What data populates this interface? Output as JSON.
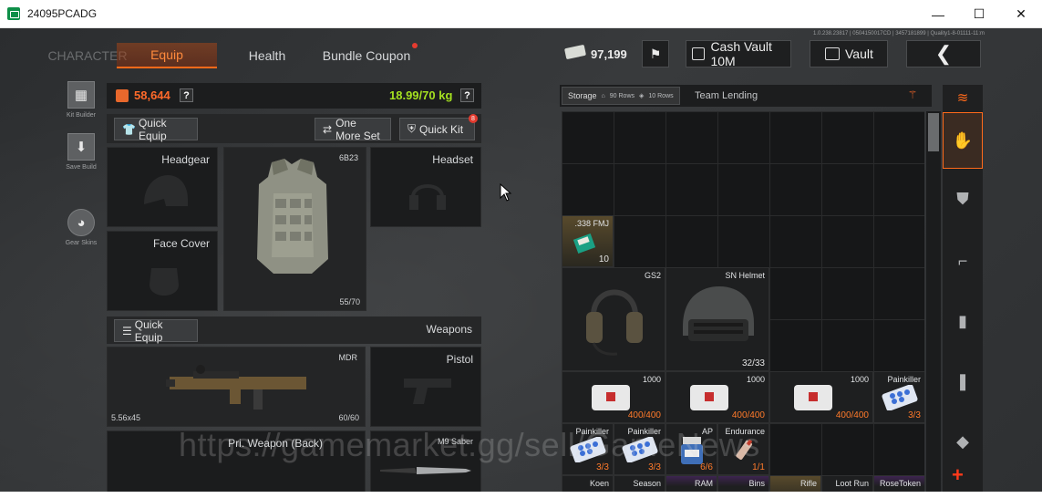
{
  "window": {
    "title": "24095PCADG",
    "minimize": "—",
    "maximize": "☐",
    "close": "✕"
  },
  "nav": {
    "character": "CHARACTER",
    "equip": "Equip",
    "health": "Health",
    "bundle": "Bundle Coupon"
  },
  "version_text": "1.0.238.23817 | 0504150017CD | 3457181899 | Quality1-8-01111-11:m",
  "currency": {
    "cash": "97,199"
  },
  "top_buttons": {
    "cash_vault": "Cash Vault 10M",
    "vault": "Vault",
    "back": "❮"
  },
  "side_tools": [
    {
      "label": "Kit Builder",
      "icon": "kit-builder-icon",
      "glyph": "▦"
    },
    {
      "label": "Save Build",
      "icon": "save-build-icon",
      "glyph": "⬇"
    },
    {
      "label": "Gear Skins",
      "icon": "gear-skins-icon",
      "glyph": "◕"
    }
  ],
  "stats": {
    "money": "58,644",
    "weight": "18.99/70 kg",
    "help": "?"
  },
  "equip_buttons": {
    "quick_equip": "Quick Equip",
    "one_more_set": "One More Set",
    "quick_kit": "Quick Kit",
    "quick_kit_badge": "8"
  },
  "gear": {
    "headgear": "Headgear",
    "armor_name": "6B23",
    "armor_durability": "55/70",
    "headset": "Headset",
    "face_cover": "Face Cover"
  },
  "weapons": {
    "quick_equip": "Quick Equip",
    "title": "Weapons",
    "primary_name": "MDR",
    "primary_caliber": "5.56x45",
    "primary_ammo": "60/60",
    "pistol": "Pistol",
    "back_slot": "Pri. Weapon (Back)",
    "melee_name": "M9 Saber"
  },
  "storage": {
    "tab": "Storage",
    "rows_90": "90 Rows",
    "rows_10": "10 Rows",
    "team_lending": "Team Lending",
    "items": [
      {
        "name": ".338 FMJ",
        "count": "10"
      },
      {
        "name": "GS2",
        "count": ""
      },
      {
        "name": "SN Helmet",
        "count": "32/33"
      },
      {
        "name": "1000",
        "count": "400/400"
      },
      {
        "name": "1000",
        "count": "400/400"
      },
      {
        "name": "1000",
        "count": "400/400"
      },
      {
        "name": "Painkiller",
        "count": "3/3"
      },
      {
        "name": "Painkiller",
        "count": "3/3"
      },
      {
        "name": "Painkiller",
        "count": "3/3"
      },
      {
        "name": "AP",
        "count": "6/6"
      },
      {
        "name": "Endurance",
        "count": "1/1"
      },
      {
        "name": "Koen",
        "count": ""
      },
      {
        "name": "Season",
        "count": ""
      },
      {
        "name": "RAM",
        "count": ""
      },
      {
        "name": "Bins",
        "count": ""
      },
      {
        "name": "Rifle",
        "count": ""
      },
      {
        "name": "Loot Run",
        "count": ""
      },
      {
        "name": "RoseToken",
        "count": ""
      }
    ]
  },
  "watermark": "https://gamemarket.gg/sell/GameNews",
  "colors": {
    "accent": "#ff6a1a",
    "money": "#ff6a2a",
    "weight": "#a4e020",
    "alert": "#e23a2e"
  },
  "categories": [
    "storage-stack-icon",
    "hand-icon",
    "armor-icon",
    "rifle-icon",
    "magazine-icon",
    "ammo-icon",
    "bag-icon",
    "add-icon"
  ]
}
